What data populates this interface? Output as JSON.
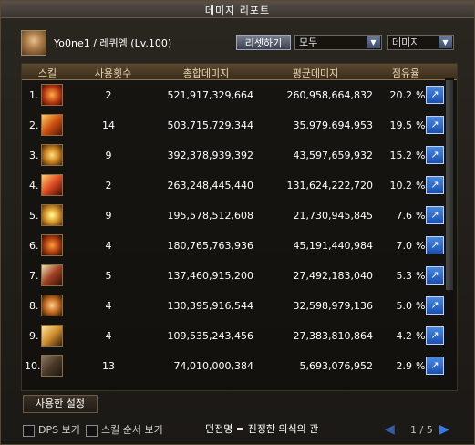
{
  "window": {
    "title": "데미지 리포트"
  },
  "header": {
    "player": "Yo0ne1 / 레퀴엠 (Lv.100)",
    "reset_label": "리셋하기",
    "filter_selected": "모두",
    "sort_selected": "데미지"
  },
  "table": {
    "columns": [
      "스킬",
      "사용횟수",
      "총합데미지",
      "평균데미지",
      "점유율"
    ],
    "rows": [
      {
        "index": "1.",
        "icon": "skill-icon-1",
        "uses": "2",
        "total": "521,917,329,664",
        "avg": "260,958,664,832",
        "share": "20.2",
        "pct": "%"
      },
      {
        "index": "2.",
        "icon": "skill-icon-2",
        "uses": "14",
        "total": "503,715,729,344",
        "avg": "35,979,694,953",
        "share": "19.5",
        "pct": "%"
      },
      {
        "index": "3.",
        "icon": "skill-icon-3",
        "uses": "9",
        "total": "392,378,939,392",
        "avg": "43,597,659,932",
        "share": "15.2",
        "pct": "%"
      },
      {
        "index": "4.",
        "icon": "skill-icon-4",
        "uses": "2",
        "total": "263,248,445,440",
        "avg": "131,624,222,720",
        "share": "10.2",
        "pct": "%"
      },
      {
        "index": "5.",
        "icon": "skill-icon-5",
        "uses": "9",
        "total": "195,578,512,608",
        "avg": "21,730,945,845",
        "share": "7.6",
        "pct": "%"
      },
      {
        "index": "6.",
        "icon": "skill-icon-6",
        "uses": "4",
        "total": "180,765,763,936",
        "avg": "45,191,440,984",
        "share": "7.0",
        "pct": "%"
      },
      {
        "index": "7.",
        "icon": "skill-icon-7",
        "uses": "5",
        "total": "137,460,915,200",
        "avg": "27,492,183,040",
        "share": "5.3",
        "pct": "%"
      },
      {
        "index": "8.",
        "icon": "skill-icon-8",
        "uses": "4",
        "total": "130,395,916,544",
        "avg": "32,598,979,136",
        "share": "5.0",
        "pct": "%"
      },
      {
        "index": "9.",
        "icon": "skill-icon-9",
        "uses": "4",
        "total": "109,535,243,456",
        "avg": "27,383,810,864",
        "share": "4.2",
        "pct": "%"
      },
      {
        "index": "10.",
        "icon": "skill-icon-10",
        "uses": "13",
        "total": "74,010,000,384",
        "avg": "5,693,076,952",
        "share": "2.9",
        "pct": "%"
      }
    ]
  },
  "footer": {
    "tab_used": "사용한 설정",
    "dps_label": "DPS 보기",
    "skill_order_label": "스킬 순서 보기",
    "title_text": "던전명 = 진정한 의식의 관",
    "page": "1 / 5"
  },
  "colors": {
    "accent": "#1a50b0",
    "header_bg": "#3a2c1a",
    "text": "#ffffff"
  }
}
